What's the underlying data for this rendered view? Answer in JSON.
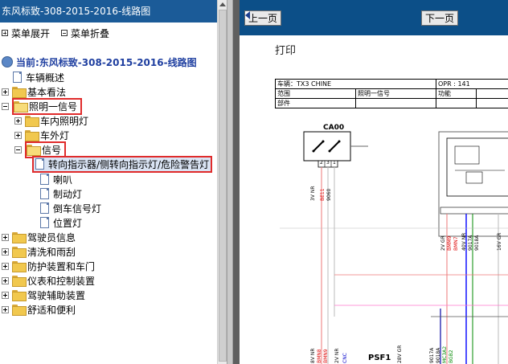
{
  "left_panel": {
    "title": "东风标致-308-2015-2016-线路图",
    "menu_expand": "菜单展开",
    "menu_collapse": "菜单折叠",
    "tree": {
      "root": "当前:东风标致-308-2015-2016-线路图",
      "items": [
        {
          "label": "车辆概述"
        },
        {
          "label": "基本看法"
        },
        {
          "label": "照明一信号"
        },
        {
          "label": "车内照明灯"
        },
        {
          "label": "车外灯"
        },
        {
          "label": "信号"
        },
        {
          "label": "转向指示器/侧转向指示灯/危险警告灯"
        },
        {
          "label": "喇叭"
        },
        {
          "label": "制动灯"
        },
        {
          "label": "倒车信号灯"
        },
        {
          "label": "位置灯"
        },
        {
          "label": "驾驶员信息"
        },
        {
          "label": "清洗和雨刮"
        },
        {
          "label": "防护装置和车门"
        },
        {
          "label": "仪表和控制装置"
        },
        {
          "label": "驾驶辅助装置"
        },
        {
          "label": "舒适和便利"
        }
      ]
    }
  },
  "right_panel": {
    "prev_page": "上一页",
    "next_page": "下一页",
    "print": "打印",
    "table": {
      "vehicle": "车辆：TX3 CHINE",
      "opr": "OPR : 141",
      "scope": "范围",
      "scope_value": "照明一信号",
      "function": "功能",
      "part": "部件"
    },
    "diagram": {
      "component_ca00": "CA00",
      "component_psf1": "PSF1",
      "wire_labels": [
        "3V NR",
        "BE11",
        "9060",
        "2V GR",
        "BMM9",
        "BMN7",
        "40V NR",
        "9017A",
        "9018A",
        "16V GR",
        "8V NR",
        "BMN8",
        "BMN9",
        "2V NR",
        "CNC",
        "28V GR",
        "9017A",
        "9018A",
        "MC3A2",
        "BGB2"
      ],
      "pin_labels": [
        "2",
        "3",
        "1"
      ]
    }
  }
}
